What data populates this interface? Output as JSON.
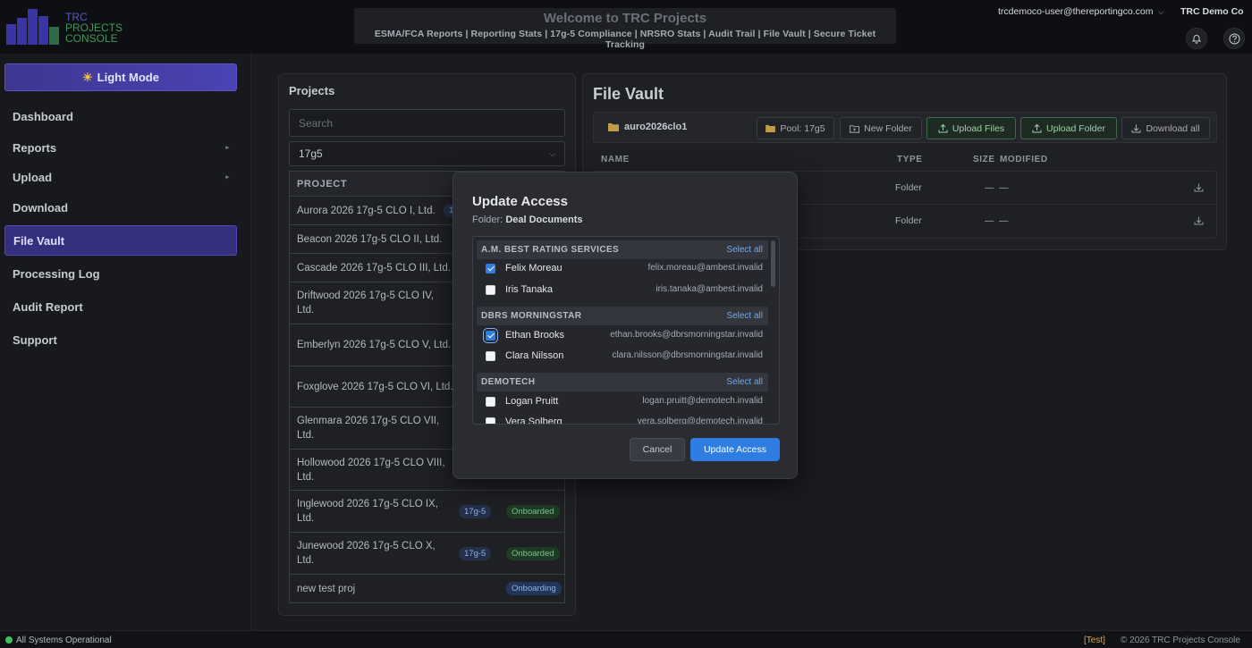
{
  "header": {
    "logo_lines": [
      "TRC",
      "PROJECTS",
      "CONSOLE"
    ],
    "welcome_title": "Welcome to TRC Projects",
    "welcome_sub": "ESMA/FCA Reports | Reporting Stats | 17g-5 Compliance | NRSRO Stats | Audit Trail | File Vault | Secure Ticket Tracking",
    "user_email": "trcdemoco-user@thereportingco.com",
    "company": "TRC Demo Co"
  },
  "sidebar": {
    "light_mode": "Light Mode",
    "items": [
      {
        "label": "Dashboard"
      },
      {
        "label": "Reports"
      },
      {
        "label": "Upload"
      },
      {
        "label": "Download"
      },
      {
        "label": "File Vault"
      },
      {
        "label": "Processing Log"
      },
      {
        "label": "Audit Report"
      },
      {
        "label": "Support"
      }
    ]
  },
  "projects": {
    "title": "Projects",
    "search_placeholder": "Search",
    "filter_value": "17g5",
    "column": "PROJECT",
    "rows": [
      {
        "name": "Aurora 2026 17g-5 CLO I, Ltd.",
        "type": "1",
        "status": ""
      },
      {
        "name": "Beacon 2026 17g-5 CLO II, Ltd.",
        "type": "",
        "status": ""
      },
      {
        "name": "Cascade 2026 17g-5 CLO III, Ltd.",
        "type": "",
        "status": ""
      },
      {
        "name": "Driftwood 2026 17g-5 CLO IV, Ltd.",
        "type": "",
        "status": ""
      },
      {
        "name": "Emberlyn 2026 17g-5 CLO V, Ltd.",
        "type": "",
        "status": ""
      },
      {
        "name": "Foxglove 2026 17g-5 CLO VI, Ltd.",
        "type": "",
        "status": ""
      },
      {
        "name": "Glenmara 2026 17g-5 CLO VII, Ltd.",
        "type": "",
        "status": ""
      },
      {
        "name": "Hollowood 2026 17g-5 CLO VIII, Ltd.",
        "type": "",
        "status": ""
      },
      {
        "name": "Inglewood 2026 17g-5 CLO IX, Ltd.",
        "type": "17g-5",
        "status": "Onboarded"
      },
      {
        "name": "Junewood 2026 17g-5 CLO X, Ltd.",
        "type": "17g-5",
        "status": "Onboarded"
      },
      {
        "name": "new test proj",
        "type": "",
        "status": "Onboarding"
      }
    ]
  },
  "vault": {
    "title": "File Vault",
    "breadcrumb": "auro2026clo1",
    "pool": "Pool: 17g5",
    "new_folder": "New Folder",
    "upload_files": "Upload Files",
    "upload_folder": "Upload Folder",
    "download_all": "Download all",
    "columns": {
      "name": "NAME",
      "type": "TYPE",
      "size": "SIZE",
      "modified": "MODIFIED"
    },
    "rows": [
      {
        "type": "Folder",
        "size": "—",
        "modified": "—"
      },
      {
        "type": "Folder",
        "size": "—",
        "modified": "—"
      }
    ]
  },
  "modal": {
    "title": "Update Access",
    "folder_label": "Folder:",
    "folder_name": "Deal Documents",
    "select_all": "Select all",
    "groups": [
      {
        "name": "A.M. BEST RATING SERVICES",
        "members": [
          {
            "name": "Felix Moreau",
            "email": "felix.moreau@ambest.invalid",
            "checked": true
          },
          {
            "name": "Iris Tanaka",
            "email": "iris.tanaka@ambest.invalid",
            "checked": false
          }
        ]
      },
      {
        "name": "DBRS MORNINGSTAR",
        "members": [
          {
            "name": "Ethan Brooks",
            "email": "ethan.brooks@dbrsmorningstar.invalid",
            "checked": true
          },
          {
            "name": "Clara Nilsson",
            "email": "clara.nilsson@dbrsmorningstar.invalid",
            "checked": false
          }
        ]
      },
      {
        "name": "DEMOTECH",
        "members": [
          {
            "name": "Logan Pruitt",
            "email": "logan.pruitt@demotech.invalid",
            "checked": false
          },
          {
            "name": "Vera Solberg",
            "email": "vera.solberg@demotech.invalid",
            "checked": false
          }
        ]
      }
    ],
    "cancel": "Cancel",
    "update": "Update Access"
  },
  "footer": {
    "status": "All Systems Operational",
    "env": "[Test]",
    "copyright": "© 2026 TRC Projects Console"
  },
  "colors": {
    "accent": "#4a43b3",
    "primary": "#2f7de0",
    "success": "#3cc45c",
    "env": "#d2a545"
  }
}
